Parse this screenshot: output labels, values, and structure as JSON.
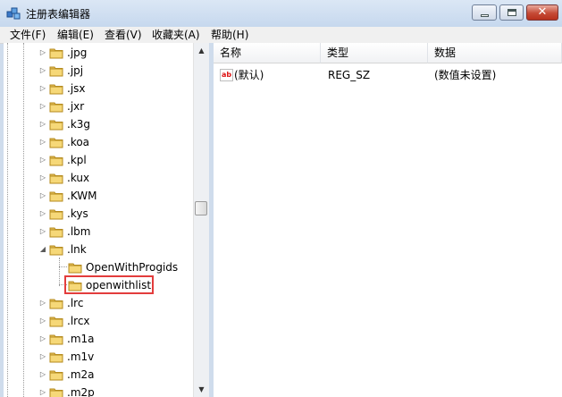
{
  "window": {
    "title": "注册表编辑器",
    "close_glyph": "✕"
  },
  "menu": [
    "文件(F)",
    "编辑(E)",
    "查看(V)",
    "收藏夹(A)",
    "帮助(H)"
  ],
  "tree": {
    "items": [
      {
        "label": ".jpg",
        "expander": "▷"
      },
      {
        "label": ".jpj",
        "expander": "▷"
      },
      {
        "label": ".jsx",
        "expander": "▷"
      },
      {
        "label": ".jxr",
        "expander": "▷"
      },
      {
        "label": ".k3g",
        "expander": "▷"
      },
      {
        "label": ".koa",
        "expander": "▷"
      },
      {
        "label": ".kpl",
        "expander": "▷"
      },
      {
        "label": ".kux",
        "expander": "▷"
      },
      {
        "label": ".KWM",
        "expander": "▷"
      },
      {
        "label": ".kys",
        "expander": "▷"
      },
      {
        "label": ".lbm",
        "expander": "▷"
      },
      {
        "label": ".lnk",
        "expander": "◢"
      },
      {
        "label": "OpenWithProgids",
        "expander": ""
      },
      {
        "label": "openwithlist",
        "expander": ""
      },
      {
        "label": ".lrc",
        "expander": "▷"
      },
      {
        "label": ".lrcx",
        "expander": "▷"
      },
      {
        "label": ".m1a",
        "expander": "▷"
      },
      {
        "label": ".m1v",
        "expander": "▷"
      },
      {
        "label": ".m2a",
        "expander": "▷"
      },
      {
        "label": ".m2p",
        "expander": "▷"
      }
    ],
    "selected": "openwithlist"
  },
  "list": {
    "headers": [
      "名称",
      "类型",
      "数据"
    ],
    "rows": [
      {
        "icon": "ab",
        "name": "(默认)",
        "type": "REG_SZ",
        "data": "(数值未设置)"
      }
    ]
  },
  "scrollbar": {
    "up": "▲",
    "down": "▼"
  }
}
